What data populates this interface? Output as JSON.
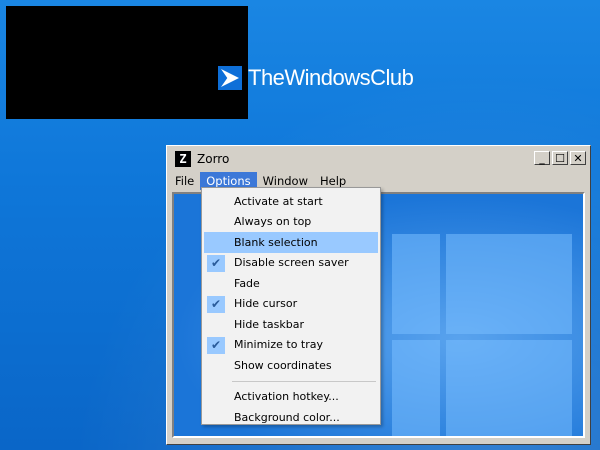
{
  "window": {
    "title": "Zorro",
    "icon_glyph": "Z",
    "buttons": {
      "minimize": "_",
      "maximize": "☐",
      "close": "✕"
    }
  },
  "menubar": {
    "items": [
      "File",
      "Options",
      "Window",
      "Help"
    ],
    "active": "Options"
  },
  "options_menu": {
    "items": [
      {
        "label": "Activate at start",
        "checked": false,
        "highlighted": false
      },
      {
        "label": "Always on top",
        "checked": false,
        "highlighted": false
      },
      {
        "label": "Blank selection",
        "checked": false,
        "highlighted": true
      },
      {
        "label": "Disable screen saver",
        "checked": true,
        "highlighted": false
      },
      {
        "label": "Fade",
        "checked": false,
        "highlighted": false
      },
      {
        "label": "Hide cursor",
        "checked": true,
        "highlighted": false
      },
      {
        "label": "Hide taskbar",
        "checked": false,
        "highlighted": false
      },
      {
        "label": "Minimize to tray",
        "checked": true,
        "highlighted": false
      },
      {
        "label": "Show coordinates",
        "checked": false,
        "highlighted": false
      }
    ],
    "extra_items": [
      {
        "label": "Activation hotkey..."
      },
      {
        "label": "Background color..."
      }
    ],
    "check_glyph": "✔"
  },
  "watermark": {
    "text": "TheWindowsClub"
  },
  "colors": {
    "desktop": "#0f77d9",
    "menu_highlight": "#99c9ff",
    "menu_active": "#3c78d8"
  }
}
